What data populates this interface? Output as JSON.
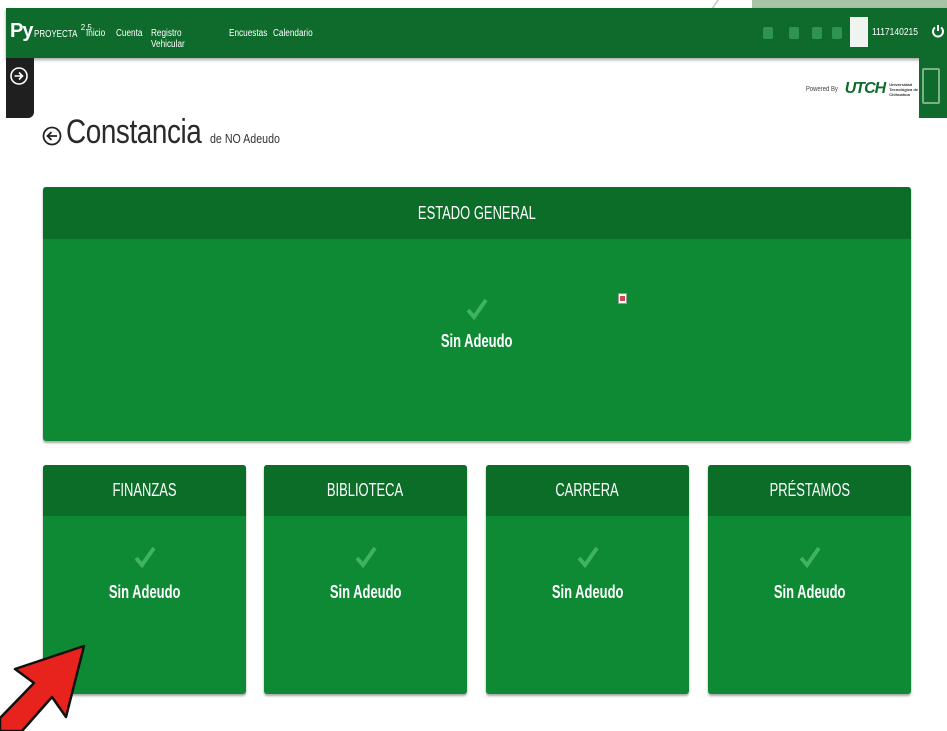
{
  "topbar": {
    "brand_py": "Py",
    "brand_name": "PROYECTA",
    "brand_version": "2.5",
    "nav": [
      "Inicio",
      "Cuenta",
      "Registro Vehicular",
      "Encuestas",
      "Calendario"
    ],
    "user_id": "1117140215"
  },
  "powered": {
    "text": "Powered By",
    "logo": "UTCH",
    "subtitle": "Universidad Tecnológica de Chihuahua"
  },
  "page": {
    "title": "Constancia",
    "subtitle": "de NO Adeudo"
  },
  "general": {
    "header": "ESTADO GENERAL",
    "status": "Sin Adeudo"
  },
  "cards": [
    {
      "header": "FINANZAS",
      "status": "Sin Adeudo"
    },
    {
      "header": "BIBLIOTECA",
      "status": "Sin Adeudo"
    },
    {
      "header": "CARRERA",
      "status": "Sin Adeudo"
    },
    {
      "header": "PRÉSTAMOS",
      "status": "Sin Adeudo"
    }
  ],
  "colors": {
    "primary": "#0f6b2c",
    "card": "#0d8a33",
    "card_header": "#0b6d28",
    "check": "#3fb35f",
    "annotation": "#e8231d"
  }
}
